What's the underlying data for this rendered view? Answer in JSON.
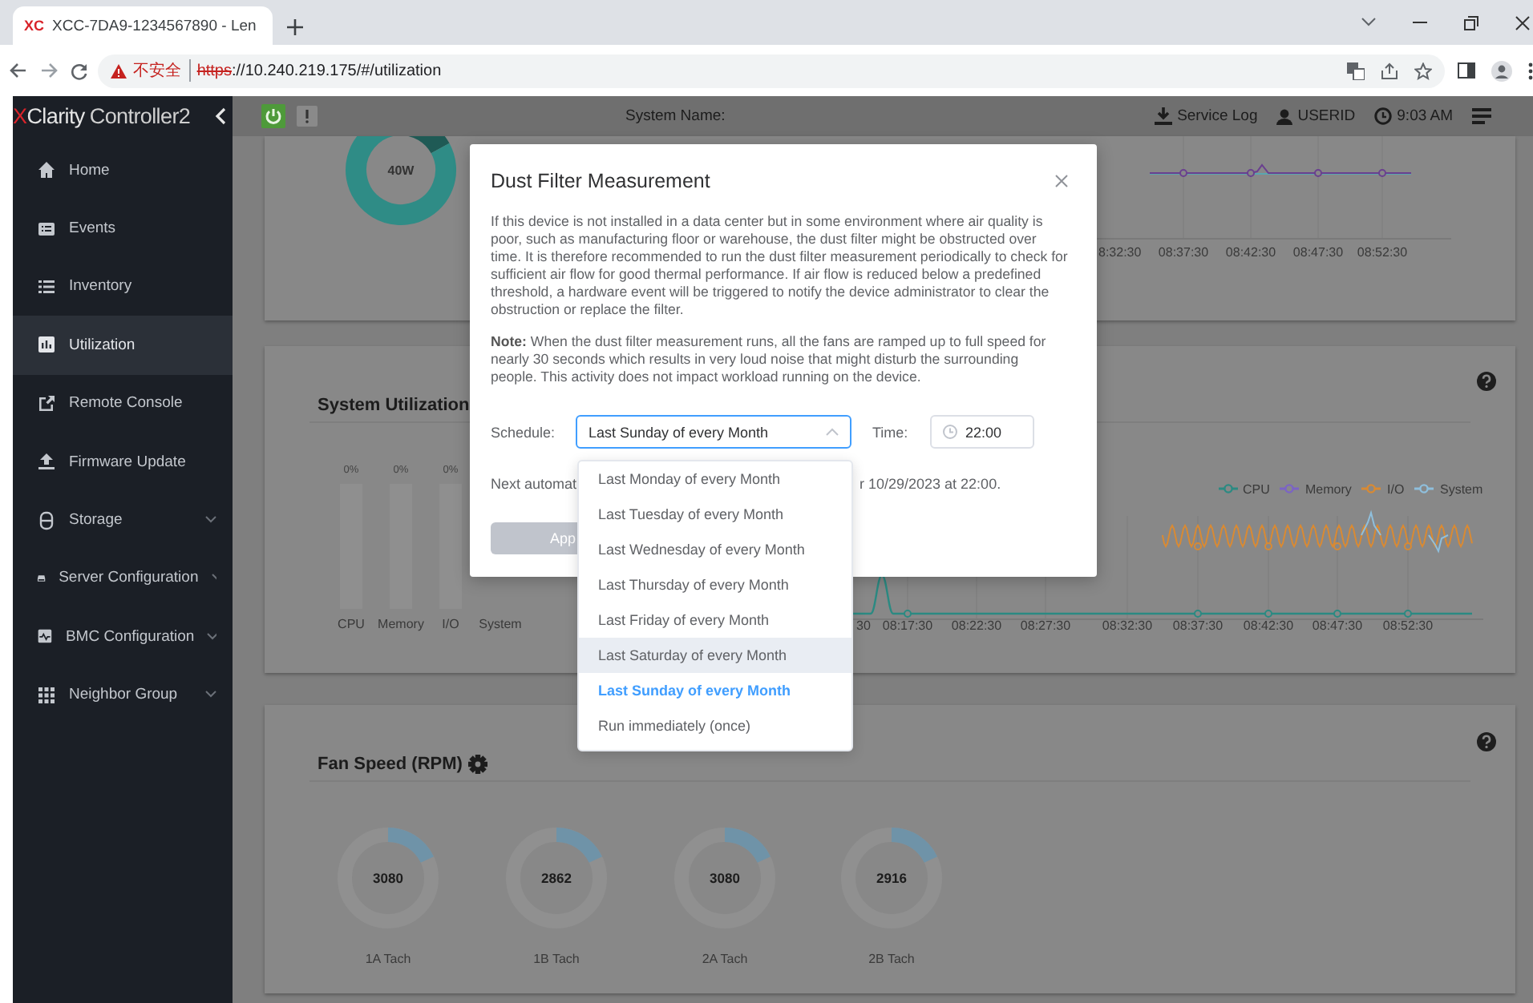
{
  "browser": {
    "favicon": "XC",
    "tab_title": "XCC-7DA9-1234567890 - Len",
    "security_label": "不安全",
    "url_scheme": "https",
    "url_rest": "://10.240.219.175/#/utilization"
  },
  "header": {
    "logo_mark": "X",
    "logo_name": "Clarity",
    "product": "Controller2",
    "system_name_label": "System Name:",
    "service_log": "Service Log",
    "user": "USERID",
    "time": "9:03 AM"
  },
  "sidebar": {
    "items": [
      {
        "label": "Home",
        "selected": false,
        "expandable": false
      },
      {
        "label": "Events",
        "selected": false,
        "expandable": false
      },
      {
        "label": "Inventory",
        "selected": false,
        "expandable": false
      },
      {
        "label": "Utilization",
        "selected": true,
        "expandable": false
      },
      {
        "label": "Remote Console",
        "selected": false,
        "expandable": false
      },
      {
        "label": "Firmware Update",
        "selected": false,
        "expandable": false
      },
      {
        "label": "Storage",
        "selected": false,
        "expandable": true
      },
      {
        "label": "Server Configuration",
        "selected": false,
        "expandable": true
      },
      {
        "label": "BMC Configuration",
        "selected": false,
        "expandable": true
      },
      {
        "label": "Neighbor Group",
        "selected": false,
        "expandable": true
      }
    ]
  },
  "power_card": {
    "gauge": {
      "reading": "40W"
    },
    "x_ticks": [
      "8:32:30",
      "08:37:30",
      "08:42:30",
      "08:47:30",
      "08:52:30"
    ]
  },
  "utilization_card": {
    "title": "System Utilization",
    "bars": [
      {
        "label": "CPU",
        "reading": "0%"
      },
      {
        "label": "Memory",
        "reading": "0%"
      },
      {
        "label": "I/O",
        "reading": "0%"
      },
      {
        "label": "System"
      }
    ],
    "legend": [
      {
        "name": "CPU",
        "color": "#2b8a82"
      },
      {
        "name": "Memory",
        "color": "#7b63c6"
      },
      {
        "name": "I/O",
        "color": "#d98a33"
      },
      {
        "name": "System",
        "color": "#8fbfdc"
      }
    ],
    "x_ticks": [
      "30",
      "08:17:30",
      "08:22:30",
      "08:27:30",
      "08:32:30",
      "08:37:30",
      "08:42:30",
      "08:47:30",
      "08:52:30"
    ]
  },
  "fan_card": {
    "title": "Fan Speed (RPM)",
    "fans": [
      {
        "name": "1A Tach",
        "reading": "3080"
      },
      {
        "name": "1B Tach",
        "reading": "2862"
      },
      {
        "name": "2A Tach",
        "reading": "3080"
      },
      {
        "name": "2B Tach",
        "reading": "2916"
      }
    ]
  },
  "dialog": {
    "title": "Dust Filter Measurement",
    "description": "If this device is not installed in a data center but in some environment where air quality is poor, such as manufacturing floor or warehouse, the dust filter might be obstructed over time. It is therefore recommended to run the dust filter measurement periodically to check for sufficient air flow for good thermal performance. If air flow is reduced below a predefined threshold, a hardware event will be triggered to notify the device administrator to clear the obstruction or replace the filter.",
    "note": "**Note:** When the dust filter measurement runs, all the fans are ramped up to full speed for nearly 30 seconds which results in very loud noise that might disturb the surrounding people. This activity does not impact workload running on the device.",
    "schedule_label": "Schedule:",
    "schedule_value": "Last Sunday of every Month",
    "time_label": "Time:",
    "time_value": "22:00",
    "next_run_start": "Next automat",
    "next_run_end": "r 10/29/2023 at 22:00.",
    "apply_button": "App"
  },
  "schedule_dropdown": {
    "options": [
      {
        "label": "Last Monday of every Month",
        "selected": false,
        "highlighted": false
      },
      {
        "label": "Last Tuesday of every Month",
        "selected": false,
        "highlighted": false
      },
      {
        "label": "Last Wednesday of every Month",
        "selected": false,
        "highlighted": false
      },
      {
        "label": "Last Thursday of every Month",
        "selected": false,
        "highlighted": false
      },
      {
        "label": "Last Friday of every Month",
        "selected": false,
        "highlighted": false
      },
      {
        "label": "Last Saturday of every Month",
        "selected": false,
        "highlighted": true
      },
      {
        "label": "Last Sunday of every Month",
        "selected": true,
        "highlighted": false
      },
      {
        "label": "Run immediately (once)",
        "selected": false,
        "highlighted": false
      }
    ]
  }
}
